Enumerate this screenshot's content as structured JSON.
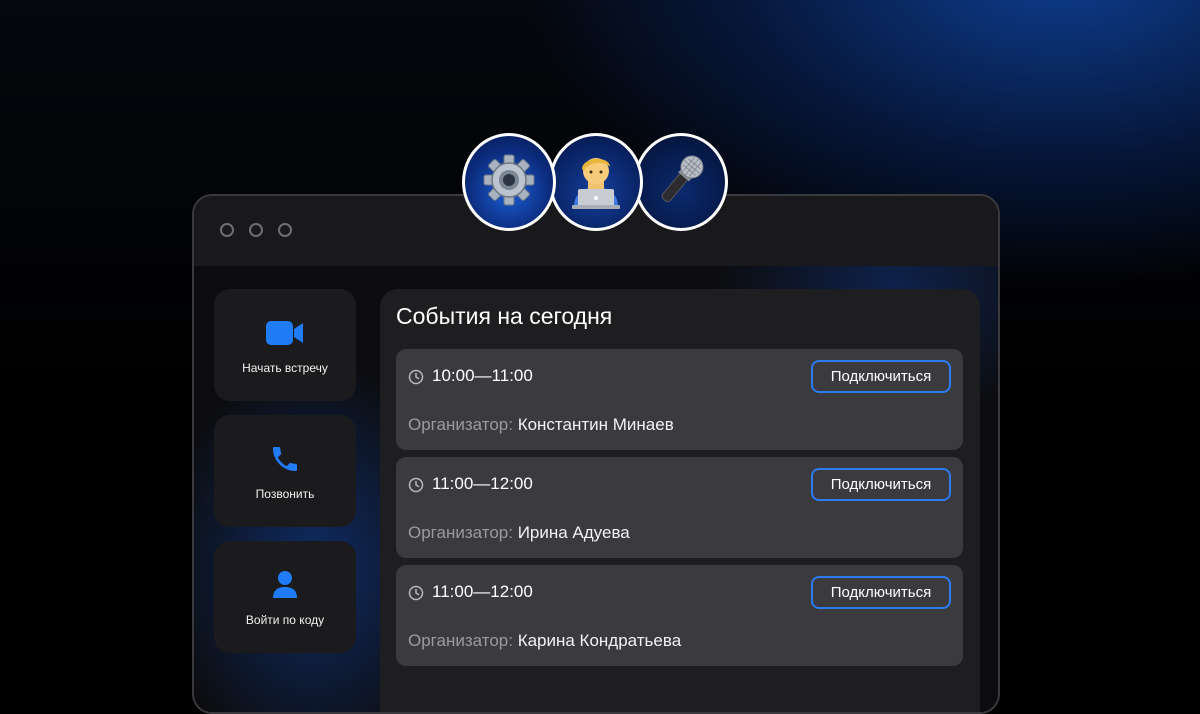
{
  "avatars": [
    {
      "icon": "gear-icon"
    },
    {
      "icon": "developer-with-laptop-icon"
    },
    {
      "icon": "microphone-icon"
    }
  ],
  "sidebar": {
    "items": [
      {
        "label": "Начать встречу",
        "icon": "video-camera-icon"
      },
      {
        "label": "Позвонить",
        "icon": "phone-icon"
      },
      {
        "label": "Войти по коду",
        "icon": "user-icon"
      }
    ]
  },
  "events_panel": {
    "title": "События на сегодня",
    "events": [
      {
        "time": "10:00—11:00",
        "organizer_label": "Организатор:",
        "organizer": "Константин Минаев",
        "join_label": "Подключиться"
      },
      {
        "time": "11:00—12:00",
        "organizer_label": "Организатор:",
        "organizer": "Ирина Адуева",
        "join_label": "Подключиться"
      },
      {
        "time": "11:00—12:00",
        "organizer_label": "Организатор:",
        "organizer": "Карина Кондратьева",
        "join_label": "Подключиться"
      }
    ]
  },
  "colors": {
    "accent": "#2a7cf0",
    "icon_blue": "#1f7cf6",
    "card_bg": "#3a3a3f",
    "panel_bg": "#1e1e20"
  }
}
